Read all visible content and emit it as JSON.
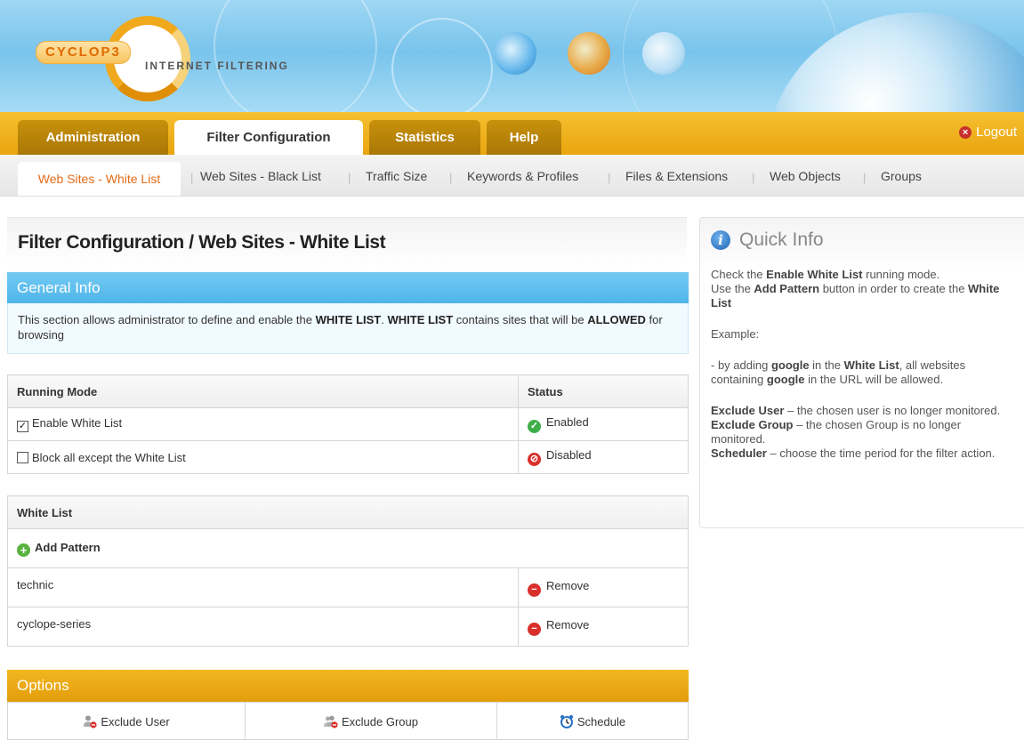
{
  "banner": {
    "logo_text": "CYCLOP3",
    "logo_subtitle": "INTERNET FILTERING"
  },
  "tabs": [
    {
      "label": "Administration",
      "active": false
    },
    {
      "label": "Filter Configuration",
      "active": true
    },
    {
      "label": "Statistics",
      "active": false
    },
    {
      "label": "Help",
      "active": false
    }
  ],
  "logout_label": "Logout",
  "subnav": [
    {
      "label": "Web Sites - White List",
      "active": true
    },
    {
      "label": "Web Sites - Black List"
    },
    {
      "label": "Traffic Size"
    },
    {
      "label": "Keywords & Profiles"
    },
    {
      "label": "Files & Extensions"
    },
    {
      "label": "Web Objects"
    },
    {
      "label": "Groups"
    }
  ],
  "page_title": "Filter Configuration / Web Sites - White List",
  "general_info": {
    "heading": "General Info",
    "text_1": "This section allows administrator to define and enable the ",
    "bold_1": "WHITE LIST",
    "text_2": ". ",
    "bold_2": "WHITE LIST",
    "text_3": " contains sites that will be ",
    "bold_3": "ALLOWED",
    "text_4": " for browsing"
  },
  "running_mode": {
    "col_mode": "Running Mode",
    "col_status": "Status",
    "rows": [
      {
        "label": "Enable White List",
        "checked": true,
        "status": "Enabled"
      },
      {
        "label": "Block all except the White List",
        "checked": false,
        "status": "Disabled"
      }
    ]
  },
  "white_list": {
    "heading": "White List",
    "add_label": "Add Pattern",
    "remove_label": "Remove",
    "items": [
      "technic",
      "cyclope-series"
    ]
  },
  "options": {
    "heading": "Options",
    "exclude_user": "Exclude User",
    "exclude_group": "Exclude Group",
    "schedule": "Schedule"
  },
  "quick_info": {
    "title": "Quick Info",
    "p1_a": "Check the ",
    "p1_b": "Enable White List",
    "p1_c": " running mode.",
    "p2_a": "Use the ",
    "p2_b": "Add Pattern",
    "p2_c": " button in order to create the ",
    "p2_d": "White List",
    "example": "Example:",
    "p3_a": "- by adding ",
    "p3_b": "google",
    "p3_c": " in the ",
    "p3_d": "White List",
    "p3_e": ", all websites containing ",
    "p3_f": "google",
    "p3_g": " in the URL will be allowed.",
    "eu_b": "Exclude User",
    "eu_t": " – the chosen user is no longer monitored.",
    "eg_b": "Exclude Group",
    "eg_t": " – the chosen Group is no longer monitored.",
    "sc_b": "Scheduler",
    "sc_t": " – choose the time period for the filter action."
  },
  "colors": {
    "accent_orange": "#e9a50f",
    "accent_blue": "#4fb6ea",
    "active_subnav": "#e36b17"
  }
}
